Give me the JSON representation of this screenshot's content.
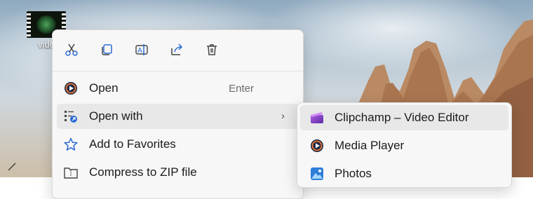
{
  "desktop": {
    "file_icon_label": "vide"
  },
  "context_menu": {
    "toolbar": [
      {
        "name": "cut",
        "icon": "scissors-icon",
        "color": "#2a6ad4"
      },
      {
        "name": "copy",
        "icon": "copy-icon",
        "color": "#2a6ad4"
      },
      {
        "name": "rename",
        "icon": "rename-icon",
        "color": "#2a6ad4"
      },
      {
        "name": "share",
        "icon": "share-icon",
        "color": "#2a6ad4"
      },
      {
        "name": "delete",
        "icon": "trash-icon",
        "color": "#444444"
      }
    ],
    "items": [
      {
        "label": "Open",
        "shortcut": "Enter",
        "icon": "media-player-icon"
      },
      {
        "label": "Open with",
        "arrow": "›",
        "icon": "open-with-icon",
        "highlighted": true
      },
      {
        "label": "Add to Favorites",
        "icon": "star-icon"
      },
      {
        "label": "Compress to ZIP file",
        "icon": "zip-folder-icon"
      }
    ]
  },
  "submenu": {
    "items": [
      {
        "label": "Clipchamp – Video Editor",
        "icon": "clipchamp-icon",
        "highlighted": true
      },
      {
        "label": "Media Player",
        "icon": "media-player-icon"
      },
      {
        "label": "Photos",
        "icon": "photos-icon"
      }
    ]
  }
}
